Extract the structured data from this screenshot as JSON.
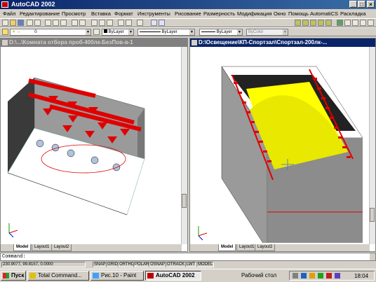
{
  "app": {
    "title": "AutoCAD 2002"
  },
  "menu": [
    "Файл",
    "Редактирование",
    "Просмотр",
    "Вставка",
    "Формат",
    "Инструменты",
    "Рисование",
    "Размерность",
    "Модификация",
    "Окно",
    "Помощь",
    "AutomatiCS",
    "Раскладка"
  ],
  "layers": {
    "layer_value": "0",
    "color_value": "ByLayer",
    "linetype_value": "ByLayer",
    "lineweight_value": "ByLayer",
    "plotstyle_value": "ByColor"
  },
  "left_window": {
    "title": "D:\\...\\Комната отбора проб-400лк-БезПов-в-1",
    "tabs": [
      "Model",
      "Layout1",
      "Layout2"
    ]
  },
  "right_window": {
    "title": "D:\\Освещение\\КП-Спортзал\\Спортзал-200лк-...",
    "tabs": [
      "Model",
      "Layout1",
      "Layout2"
    ]
  },
  "command": {
    "prompt": "Command:"
  },
  "status": {
    "coords": "230.9077, 99.8157, 0.0000",
    "toggles": [
      "SNAP",
      "GRID",
      "ORTHO",
      "POLAR",
      "OSNAP",
      "OTRACK",
      "LWT",
      "MODEL"
    ]
  },
  "taskbar": {
    "start_label": "Пуск",
    "items": [
      "Total Command...",
      "Рис.10 - Paint",
      "AutoCAD 2002"
    ],
    "desktop_label": "Рабочий стол",
    "clock": "18:04"
  },
  "colors": {
    "accent": "#0a246a",
    "lamp_red": "#e00000",
    "floor_yellow": "#ffff00",
    "wall_gray": "#9a9a9a"
  }
}
